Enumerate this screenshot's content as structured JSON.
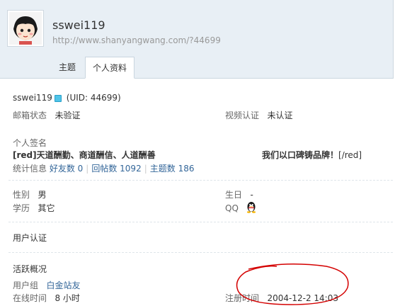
{
  "header": {
    "username": "sswei119",
    "url": "http://www.shanyangwang.com/?44699",
    "tabs": [
      {
        "label": "主题"
      },
      {
        "label": "个人资料"
      }
    ]
  },
  "profile": {
    "name": "sswei119",
    "uid": "(UID: 44699)",
    "email_label": "邮箱状态",
    "email_value": "未验证",
    "video_label": "视频认证",
    "video_value": "未认证",
    "signature_label": "个人签名",
    "signature_left": "[red]天道酬勤、商道酬信、人道酬善",
    "signature_right_bold": "我们以口碑铸品牌！",
    "signature_right_tail": "[/red]",
    "stats_label": "统计信息",
    "friends": "好友数 0",
    "replies": "回帖数 1092",
    "topics": "主题数 186",
    "gender_label": "性别",
    "gender_value": "男",
    "birthday_label": "生日",
    "birthday_value": "-",
    "education_label": "学历",
    "education_value": "其它",
    "qq_label": "QQ",
    "auth_title": "用户认证",
    "activity_title": "活跃概况",
    "group_label": "用户组",
    "group_value": "白金站友",
    "online_label": "在线时间",
    "online_value": "8 小时",
    "register_label": "注册时间",
    "register_value": "2004-12-2 14:03"
  },
  "colors": {
    "header_bg": "#e8eff5",
    "link": "#336699",
    "annotation_circle": "#d40000"
  },
  "icons": [
    "avatar-cartoon-girl",
    "verified-icon",
    "qq-penguin-icon"
  ]
}
